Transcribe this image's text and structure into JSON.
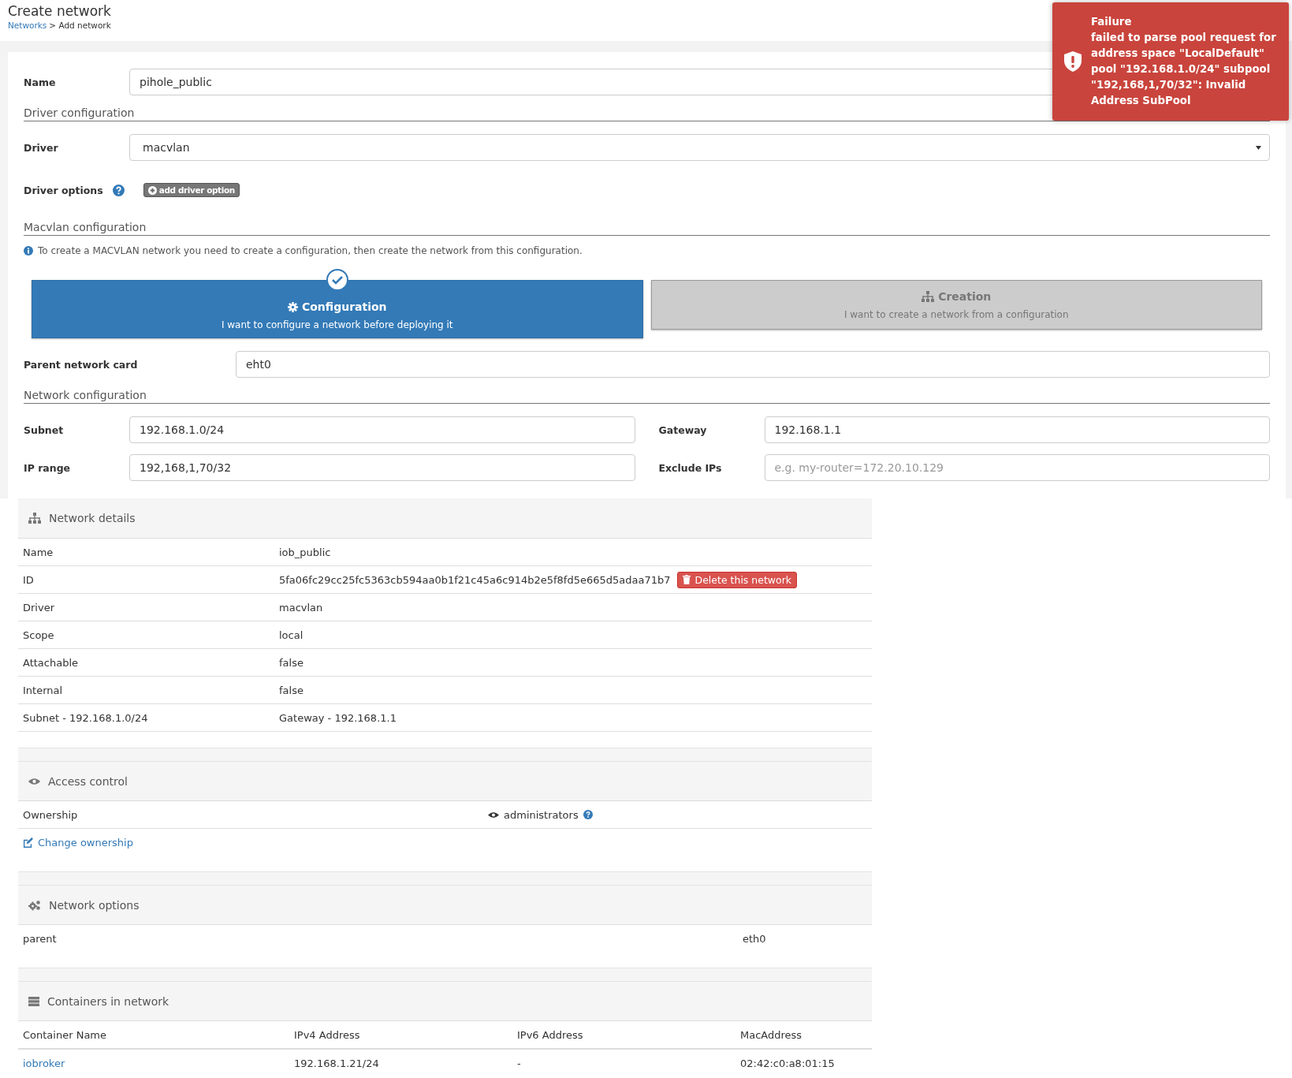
{
  "header": {
    "title": "Create network",
    "breadcrumb_link": "Networks",
    "breadcrumb_current": "> Add network"
  },
  "form": {
    "name_field": {
      "label": "Name",
      "value": "pihole_public"
    },
    "driver_section": {
      "heading": "Driver configuration",
      "driver": {
        "label": "Driver",
        "value": "macvlan"
      },
      "options_label": "Driver options",
      "add_option_button": "add driver option"
    },
    "macvlan_section": {
      "heading": "Macvlan configuration",
      "info": "To create a MACVLAN network you need to create a configuration, then create the network from this configuration.",
      "modes": [
        {
          "title": "Configuration",
          "description": "I want to configure a network before deploying it",
          "selected": true
        },
        {
          "title": "Creation",
          "description": "I want to create a network from a configuration",
          "selected": false
        }
      ],
      "parent_card": {
        "label": "Parent network card",
        "value": "eht0"
      }
    },
    "network_section": {
      "heading": "Network configuration",
      "fields": [
        {
          "label": "Subnet",
          "value": "192.168.1.0/24"
        },
        {
          "label": "Gateway",
          "value": "192.168.1.1"
        },
        {
          "label": "IP range",
          "value": "192,168,1,70/32"
        },
        {
          "label": "Exclude IPs",
          "placeholder": "e.g. my-router=172.20.10.129"
        }
      ]
    }
  },
  "network_details": {
    "title": "Network details",
    "rows": [
      {
        "label": "Name",
        "value": "iob_public"
      },
      {
        "label": "ID",
        "value": "5fa06fc29cc25fc5363cb594aa0b1f21c45a6c914b2e5f8fd5e665d5adaa71b7",
        "button": "Delete this network"
      },
      {
        "label": "Driver",
        "value": "macvlan"
      },
      {
        "label": "Scope",
        "value": "local"
      },
      {
        "label": "Attachable",
        "value": "false"
      },
      {
        "label": "Internal",
        "value": "false"
      },
      {
        "label": "Subnet - 192.168.1.0/24",
        "value": "Gateway - 192.168.1.1"
      }
    ]
  },
  "access_control": {
    "title": "Access control",
    "ownership_label": "Ownership",
    "ownership_value": "administrators",
    "change_link": "Change ownership"
  },
  "network_options": {
    "title": "Network options",
    "rows": [
      {
        "key": "parent",
        "value": "eth0"
      }
    ]
  },
  "containers": {
    "title": "Containers in network",
    "columns": [
      "Container Name",
      "IPv4 Address",
      "IPv6 Address",
      "MacAddress"
    ],
    "rows": [
      {
        "name": "iobroker",
        "ipv4": "192.168.1.21/24",
        "ipv6": "-",
        "mac": "02:42:c0:a8:01:15"
      }
    ]
  },
  "toast": {
    "title": "Failure",
    "message": "failed to parse pool request for address space \"LocalDefault\" pool \"192.168.1.0/24\" subpool \"192,168,1,70/32\": Invalid Address SubPool"
  }
}
